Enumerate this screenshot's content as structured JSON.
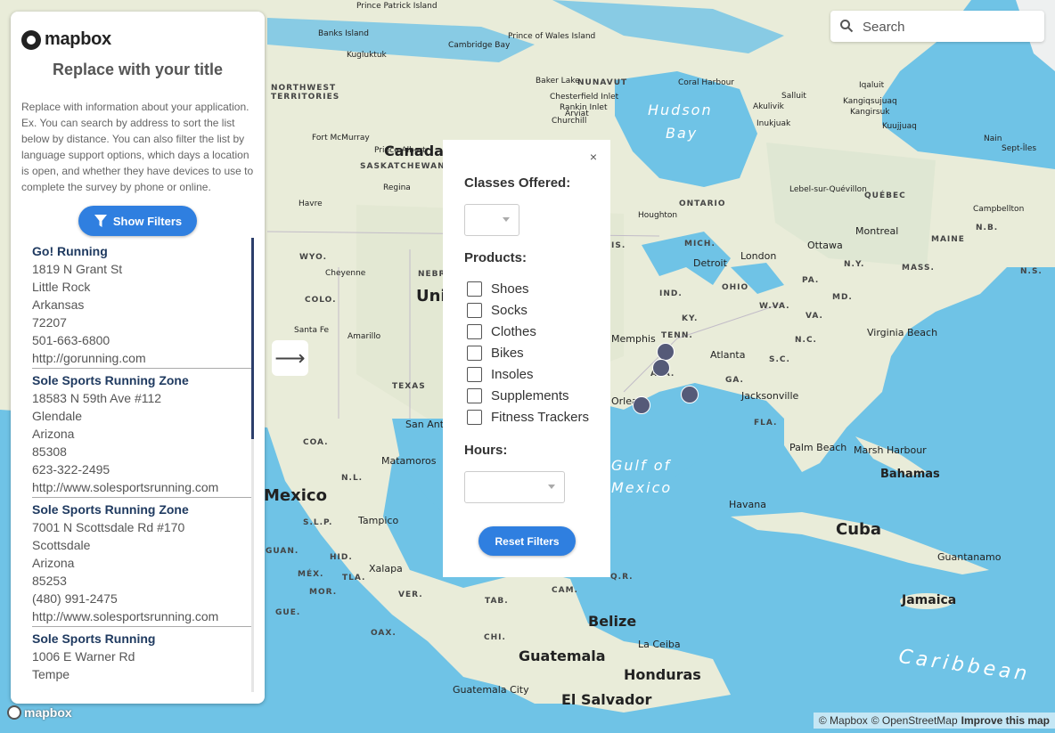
{
  "map": {
    "water_labels": [
      "Hudson",
      "Bay",
      "Caribbean",
      "Gulf of",
      "Mexico"
    ],
    "country_labels": [
      "Canada",
      "Cuba",
      "Belize",
      "Guatemala",
      "Honduras",
      "El Salvador",
      "Jamaica",
      "Bahamas",
      "Mexico",
      "Unit"
    ],
    "region_labels": [
      "NORTHWEST TERRITORIES",
      "NUNAVUT",
      "SASKATCHEWAN",
      "ONTARIO",
      "QUÉBEC",
      "MICH.",
      "IND.",
      "OHIO",
      "KY.",
      "TENN.",
      "ALA.",
      "GA.",
      "S.C.",
      "N.C.",
      "VA.",
      "W.VA.",
      "PA.",
      "N.Y.",
      "MASS.",
      "MD.",
      "FLA.",
      "TEXAS",
      "WYO.",
      "NEBR.",
      "COLO.",
      "MAINE",
      "N.B.",
      "N.S.",
      "COA.",
      "N.L.",
      "S.L.P.",
      "GUAN.",
      "HID.",
      "MÉX.",
      "TLA.",
      "MOR.",
      "VER.",
      "GUE.",
      "OAX.",
      "CHI.",
      "TAB.",
      "CAM.",
      "Q.R.",
      "IS."
    ],
    "city_labels": [
      "Prince Patrick Island",
      "Banks Island",
      "Cambridge Bay",
      "Prince of Wales Island",
      "Kugluktuk",
      "Baker Lake",
      "Coral Harbour",
      "Iqaluit",
      "Kangiqsujuaq",
      "Kangirsuk",
      "Salluit",
      "Akulivik",
      "Inukjuak",
      "Kuujjuaq",
      "Nain",
      "Chesterfield Inlet",
      "Rankin Inlet",
      "Arviat",
      "Churchill",
      "Fort McMurray",
      "Prince Albert",
      "Regina",
      "Havre",
      "Cheyenne",
      "Santa Fe",
      "Amarillo",
      "Lebel-sur-Quévillon",
      "Sept-Îles",
      "Campbellton",
      "Houghton",
      "Ottawa",
      "Montreal",
      "Detroit",
      "London",
      "Virginia Beach",
      "Atlanta",
      "Jacksonville",
      "Palm Beach",
      "Marsh Harbour",
      "Havana",
      "Guantanamo",
      "San Antonio",
      "Matamoros",
      "Tampico",
      "Xalapa",
      "La Ceiba",
      "Guatemala City",
      "Memphis",
      "Orleans"
    ]
  },
  "sidebar": {
    "logo_text": "mapbox",
    "title": "Replace with your title",
    "description": "Replace with information about your application. Ex. You can search by address to sort the list below by distance. You can also filter the list by language support options, which days a location is open, and whether they have devices to use to complete the survey by phone or online.",
    "show_filters_label": "Show Filters",
    "stores": [
      {
        "name": "Go! Running",
        "lines": [
          "1819 N Grant St",
          "Little Rock",
          "Arkansas",
          "72207",
          "501-663-6800",
          "http://gorunning.com"
        ]
      },
      {
        "name": "Sole Sports Running Zone",
        "lines": [
          "18583 N 59th Ave #112",
          "Glendale",
          "Arizona",
          "85308",
          "623-322-2495",
          "http://www.solesportsrunning.com"
        ]
      },
      {
        "name": "Sole Sports Running Zone",
        "lines": [
          "7001 N Scottsdale Rd #170",
          "Scottsdale",
          "Arizona",
          "85253",
          "(480) 991-2475",
          "http://www.solesportsrunning.com"
        ]
      },
      {
        "name": "Sole Sports Running",
        "lines": [
          "1006 E Warner Rd",
          "Tempe"
        ]
      }
    ]
  },
  "filters": {
    "close_label": "×",
    "classes_heading": "Classes Offered:",
    "products_heading": "Products:",
    "products": [
      "Shoes",
      "Socks",
      "Clothes",
      "Bikes",
      "Insoles",
      "Supplements",
      "Fitness Trackers"
    ],
    "hours_heading": "Hours:",
    "reset_label": "Reset Filters"
  },
  "toggle_arrow": "⟶",
  "search": {
    "placeholder": "Search"
  },
  "bottom_logo_text": "mapbox",
  "attribution": {
    "mapbox": "© Mapbox",
    "osm": "© OpenStreetMap",
    "improve": "Improve this map"
  },
  "colors": {
    "accent": "#2f7fe0",
    "water": "#6fc3e6",
    "land": "#e9ecd9",
    "marker": "#555a78"
  },
  "icons": [
    "search-icon",
    "filter-icon",
    "close-icon",
    "arrow-right-icon",
    "chevron-down-icon",
    "mapbox-logo-icon"
  ]
}
